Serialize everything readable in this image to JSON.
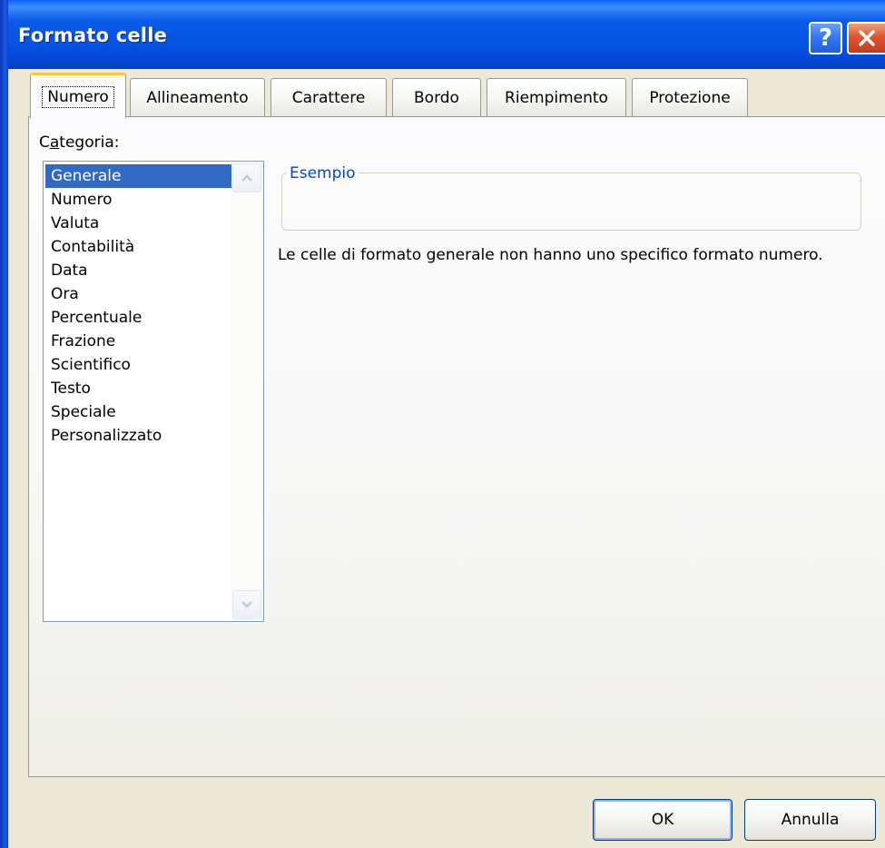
{
  "window": {
    "title": "Formato celle",
    "help_symbol": "?"
  },
  "tabs": [
    {
      "label": "Numero",
      "active": true
    },
    {
      "label": "Allineamento",
      "active": false
    },
    {
      "label": "Carattere",
      "active": false
    },
    {
      "label": "Bordo",
      "active": false
    },
    {
      "label": "Riempimento",
      "active": false
    },
    {
      "label": "Protezione",
      "active": false
    }
  ],
  "category": {
    "label_prefix": "C",
    "label_mnemonic": "a",
    "label_suffix": "tegoria:",
    "items": [
      "Generale",
      "Numero",
      "Valuta",
      "Contabilità",
      "Data",
      "Ora",
      "Percentuale",
      "Frazione",
      "Scientifico",
      "Testo",
      "Speciale",
      "Personalizzato"
    ],
    "selected": "Generale"
  },
  "sample": {
    "legend": "Esempio",
    "value": ""
  },
  "description": "Le celle di formato generale non hanno uno specifico formato numero.",
  "buttons": {
    "ok": "OK",
    "cancel": "Annulla"
  },
  "colors": {
    "titlebar": "#0553e2",
    "selection": "#316ac5",
    "active_tab_accent": "#ffc83c",
    "legend_text": "#0046d5",
    "dialog_bg": "#ece9d8"
  },
  "icons": {
    "help": "help-icon",
    "close": "close-icon",
    "scroll_up": "chevron-up-icon",
    "scroll_down": "chevron-down-icon"
  }
}
